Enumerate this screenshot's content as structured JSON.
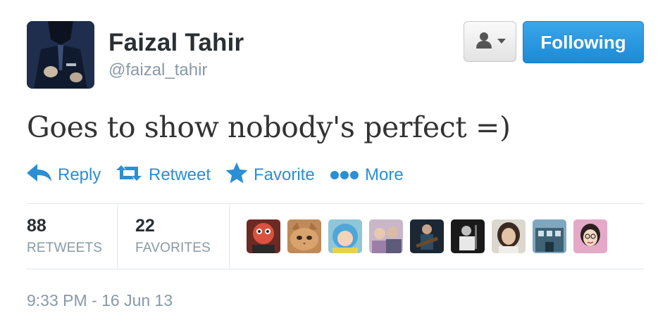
{
  "header": {
    "display_name": "Faizal Tahir",
    "screen_name": "@faizal_tahir",
    "follow_label": "Following"
  },
  "tweet": {
    "text": "Goes to show nobody's perfect =)"
  },
  "actions": {
    "reply": "Reply",
    "retweet": "Retweet",
    "favorite": "Favorite",
    "more": "More"
  },
  "stats": {
    "retweets_count": "88",
    "retweets_label": "RETWEETS",
    "favorites_count": "22",
    "favorites_label": "FAVORITES"
  },
  "favoriters": [
    {
      "icon": "user-avatar-red-face"
    },
    {
      "icon": "user-avatar-cat"
    },
    {
      "icon": "user-avatar-blue-hood-child"
    },
    {
      "icon": "user-avatar-group-photo"
    },
    {
      "icon": "user-avatar-guitarist"
    },
    {
      "icon": "user-avatar-dark-stage"
    },
    {
      "icon": "user-avatar-woman-portrait"
    },
    {
      "icon": "user-avatar-building"
    },
    {
      "icon": "user-avatar-cartoon-girl"
    }
  ],
  "timestamp": "9:33 PM - 16 Jun 13",
  "colors": {
    "accent": "#2a8fd4",
    "follow_button": "#1c8ad6",
    "muted_text": "#8899a6"
  }
}
